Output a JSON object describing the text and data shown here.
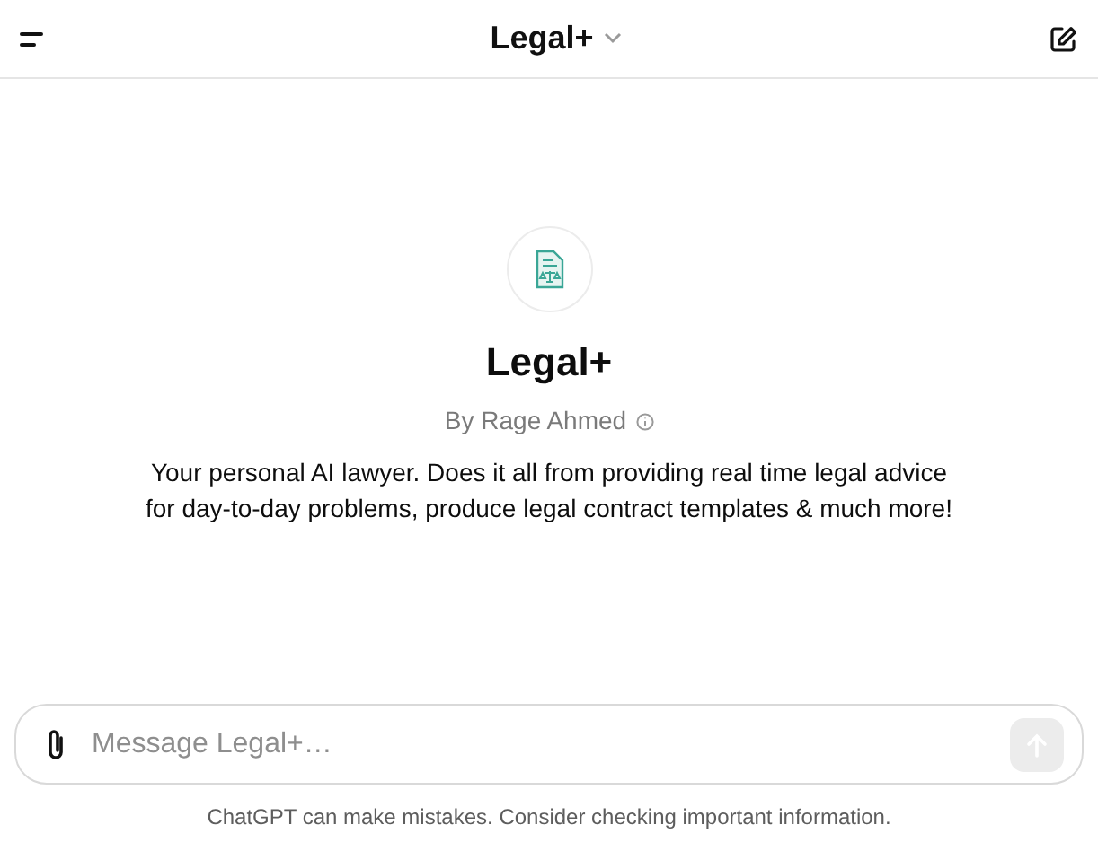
{
  "header": {
    "title": "Legal+"
  },
  "gpt": {
    "name": "Legal+",
    "author": "By Rage Ahmed",
    "description": "Your personal AI lawyer. Does it all from providing real time legal advice for day-to-day problems, produce legal contract templates & much more!"
  },
  "composer": {
    "placeholder": "Message Legal+…",
    "send_disabled": true
  },
  "disclaimer": "ChatGPT can make mistakes. Consider checking important information."
}
